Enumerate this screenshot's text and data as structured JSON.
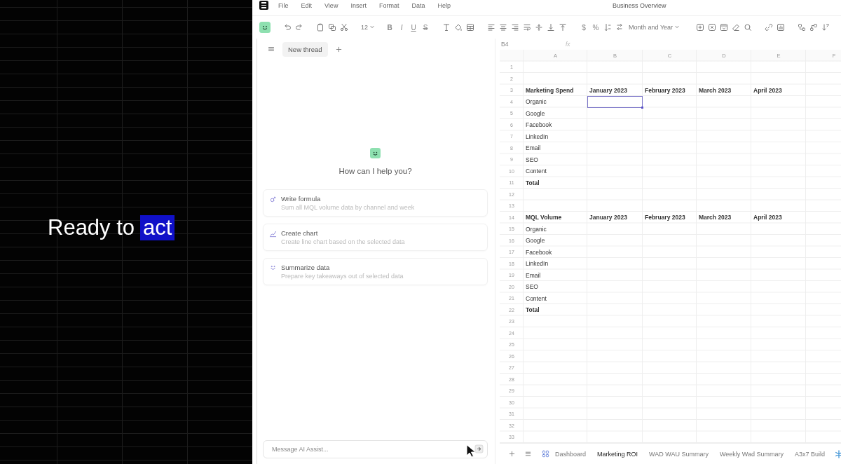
{
  "promo": {
    "caption": "Ready to",
    "highlight": "act"
  },
  "menu": {
    "items": [
      "File",
      "Edit",
      "View",
      "Insert",
      "Format",
      "Data",
      "Help"
    ],
    "document_title": "Business Overview"
  },
  "toolbar": {
    "font_size": "12",
    "text_styles": [
      "B",
      "I",
      "U",
      "S"
    ],
    "currency": "$",
    "percent": "%",
    "number_format": "Month and Year"
  },
  "chat": {
    "tabs": [
      {
        "label": "New thread",
        "selected": true
      }
    ],
    "prompt": "How can I help you?",
    "suggestions": [
      {
        "title": "Write formula",
        "description": "Sum all MQL volume data by channel and week"
      },
      {
        "title": "Create chart",
        "description": "Create line chart based on the selected data"
      },
      {
        "title": "Summarize data",
        "description": "Prepare key takeaways out of selected data"
      }
    ],
    "input": {
      "placeholder": "Message AI Assist..."
    }
  },
  "sheet": {
    "name_box": "B4",
    "formula_label": "fx",
    "columns": [
      "A",
      "B",
      "C",
      "D",
      "E",
      "F"
    ],
    "rows": [
      {
        "number": "1",
        "kind": "plain"
      },
      {
        "number": "2",
        "kind": "plain"
      },
      {
        "number": "3",
        "kind": "header",
        "cells": [
          {
            "text": "Marketing Spend",
            "selected": false
          },
          {
            "text": "January 2023",
            "selected": false
          },
          {
            "text": "February 2023",
            "selected": false
          },
          {
            "text": "March 2023",
            "selected": false
          },
          {
            "text": "April 2023",
            "selected": false
          }
        ]
      },
      {
        "number": "4",
        "kind": "plain",
        "cells": [
          {
            "text": "Organic",
            "selected": false
          },
          {
            "selected": true
          }
        ]
      },
      {
        "number": "5",
        "kind": "plain",
        "cells": [
          {
            "text": "Google",
            "selected": false
          }
        ]
      },
      {
        "number": "6",
        "kind": "plain",
        "cells": [
          {
            "text": "Facebook",
            "selected": false
          }
        ]
      },
      {
        "number": "7",
        "kind": "plain",
        "cells": [
          {
            "text": "LinkedIn",
            "selected": false
          }
        ]
      },
      {
        "number": "8",
        "kind": "plain",
        "cells": [
          {
            "text": "Email",
            "selected": false
          }
        ]
      },
      {
        "number": "9",
        "kind": "plain",
        "cells": [
          {
            "text": "SEO",
            "selected": false
          }
        ]
      },
      {
        "number": "10",
        "kind": "plain",
        "cells": [
          {
            "text": "Content",
            "selected": false
          }
        ]
      },
      {
        "number": "11",
        "kind": "total",
        "cells": [
          {
            "text": "Total",
            "selected": false
          }
        ]
      },
      {
        "number": "12",
        "kind": "plain"
      },
      {
        "number": "13",
        "kind": "plain"
      },
      {
        "number": "14",
        "kind": "header",
        "cells": [
          {
            "text": "MQL Volume",
            "selected": false
          },
          {
            "text": "January 2023",
            "selected": false
          },
          {
            "text": "February 2023",
            "selected": false
          },
          {
            "text": "March 2023",
            "selected": false
          },
          {
            "text": "April 2023",
            "selected": false
          }
        ]
      },
      {
        "number": "15",
        "kind": "plain",
        "cells": [
          {
            "text": "Organic",
            "selected": false
          }
        ]
      },
      {
        "number": "16",
        "kind": "plain",
        "cells": [
          {
            "text": "Google",
            "selected": false
          }
        ]
      },
      {
        "number": "17",
        "kind": "plain",
        "cells": [
          {
            "text": "Facebook",
            "selected": false
          }
        ]
      },
      {
        "number": "18",
        "kind": "plain",
        "cells": [
          {
            "text": "LinkedIn",
            "selected": false
          }
        ]
      },
      {
        "number": "19",
        "kind": "plain",
        "cells": [
          {
            "text": "Email",
            "selected": false
          }
        ]
      },
      {
        "number": "20",
        "kind": "plain",
        "cells": [
          {
            "text": "SEO",
            "selected": false
          }
        ]
      },
      {
        "number": "21",
        "kind": "plain",
        "cells": [
          {
            "text": "Content",
            "selected": false
          }
        ]
      },
      {
        "number": "22",
        "kind": "total",
        "cells": [
          {
            "text": "Total",
            "selected": false
          }
        ]
      },
      {
        "number": "23",
        "kind": "plain"
      },
      {
        "number": "24",
        "kind": "plain"
      },
      {
        "number": "25",
        "kind": "plain"
      },
      {
        "number": "26",
        "kind": "plain"
      },
      {
        "number": "27",
        "kind": "plain"
      },
      {
        "number": "28",
        "kind": "plain"
      },
      {
        "number": "29",
        "kind": "plain"
      },
      {
        "number": "30",
        "kind": "plain"
      },
      {
        "number": "31",
        "kind": "plain"
      },
      {
        "number": "32",
        "kind": "plain"
      },
      {
        "number": "33",
        "kind": "plain"
      }
    ],
    "tabs": [
      {
        "label": "Dashboard",
        "selected": false
      },
      {
        "label": "Marketing ROI",
        "selected": true
      },
      {
        "label": "WAD WAU Summary",
        "selected": false
      },
      {
        "label": "Weekly Wad Summary",
        "selected": false
      },
      {
        "label": "A3x7 Build",
        "selected": false
      }
    ]
  }
}
